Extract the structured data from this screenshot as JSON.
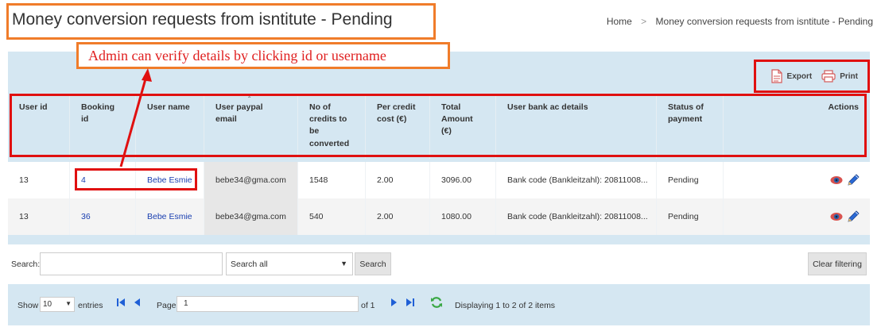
{
  "header": {
    "title": "Money conversion requests from isntitute - Pending",
    "breadcrumb": [
      {
        "label": "Home"
      },
      {
        "label": "Money conversion requests from isntitute - Pending"
      }
    ],
    "breadcrumb_separator": ">"
  },
  "annotation": {
    "text": "Admin can verify details by clicking id or username"
  },
  "toolbar": {
    "export_label": "Export",
    "print_label": "Print"
  },
  "table": {
    "columns": [
      {
        "key": "user_id",
        "label": "User id"
      },
      {
        "key": "booking_id",
        "label": "Booking id"
      },
      {
        "key": "user_name",
        "label": "User name"
      },
      {
        "key": "paypal_email",
        "label": "User paypal email"
      },
      {
        "key": "credits",
        "label": "No of credits to be converted"
      },
      {
        "key": "per_credit_cost",
        "label": "Per credit cost (€)"
      },
      {
        "key": "total",
        "label": "Total Amount (€)"
      },
      {
        "key": "bank",
        "label": "User bank ac details"
      },
      {
        "key": "status",
        "label": "Status of payment"
      },
      {
        "key": "actions",
        "label": "Actions"
      }
    ],
    "rows": [
      {
        "user_id": "13",
        "booking_id": "4",
        "user_name": "Bebe Esmie",
        "paypal_email": "bebe34@gma.com",
        "credits": "1548",
        "per_credit_cost": "2.00",
        "total": "3096.00",
        "bank": "Bank code (Bankleitzahl): 20811008...",
        "status": "Pending"
      },
      {
        "user_id": "13",
        "booking_id": "36",
        "user_name": "Bebe Esmie",
        "paypal_email": "bebe34@gma.com",
        "credits": "540",
        "per_credit_cost": "2.00",
        "total": "1080.00",
        "bank": "Bank code (Bankleitzahl): 20811008...",
        "status": "Pending"
      }
    ],
    "row_action_icons": [
      "eye-icon",
      "pencil-icon"
    ]
  },
  "search": {
    "label": "Search:",
    "value": "",
    "scope_selected": "Search all",
    "search_button": "Search",
    "clear_button": "Clear filtering"
  },
  "pager": {
    "show_label": "Show",
    "entries_value": "10",
    "entries_label": "entries",
    "page_label": "Page",
    "page_value": "1",
    "of_label": "of 1",
    "summary": "Displaying 1 to 2 of 2 items"
  },
  "colors": {
    "panel_bg": "#d5e7f2",
    "annotation_orange": "#f07c2a",
    "highlight_red": "#e01010",
    "link_blue": "#1a3fb0",
    "pager_icon_blue": "#1f5fd6",
    "refresh_green": "#3aa845"
  }
}
